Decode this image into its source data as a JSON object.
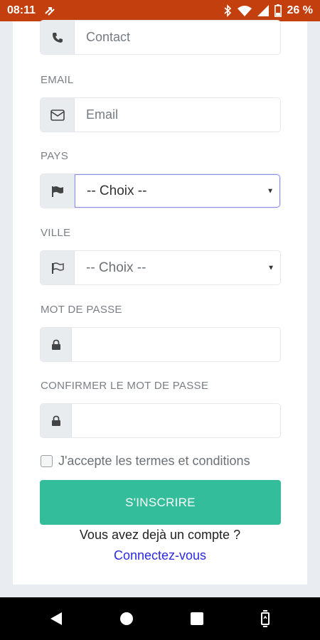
{
  "status_bar": {
    "time": "08:11",
    "left_icon": "transfer-icon",
    "battery": "26 %",
    "icons": [
      "bluetooth-icon",
      "wifi-icon",
      "signal-icon",
      "battery-icon"
    ]
  },
  "form": {
    "contact": {
      "placeholder": "Contact",
      "icon": "phone-icon"
    },
    "email": {
      "label": "EMAIL",
      "placeholder": "Email",
      "icon": "envelope-icon"
    },
    "pays": {
      "label": "PAYS",
      "selected": "-- Choix --",
      "icon": "flag-solid-icon"
    },
    "ville": {
      "label": "VILLE",
      "selected": "-- Choix --",
      "icon": "flag-outline-icon"
    },
    "password": {
      "label": "MOT DE PASSE",
      "value": "",
      "icon": "lock-icon"
    },
    "confirm_password": {
      "label": "CONFIRMER LE MOT DE PASSE",
      "value": "",
      "icon": "lock-icon"
    },
    "terms": {
      "label": "J'accepte les termes et conditions",
      "checked": false
    },
    "submit_label": "S'INSCRIRE"
  },
  "footer": {
    "already_text": "Vous avez dejà un compte ?",
    "login_link": "Connectez-vous"
  },
  "colors": {
    "status_bar": "#c33f0d",
    "primary_button": "#34bd9b",
    "link": "#2a2ae0"
  }
}
